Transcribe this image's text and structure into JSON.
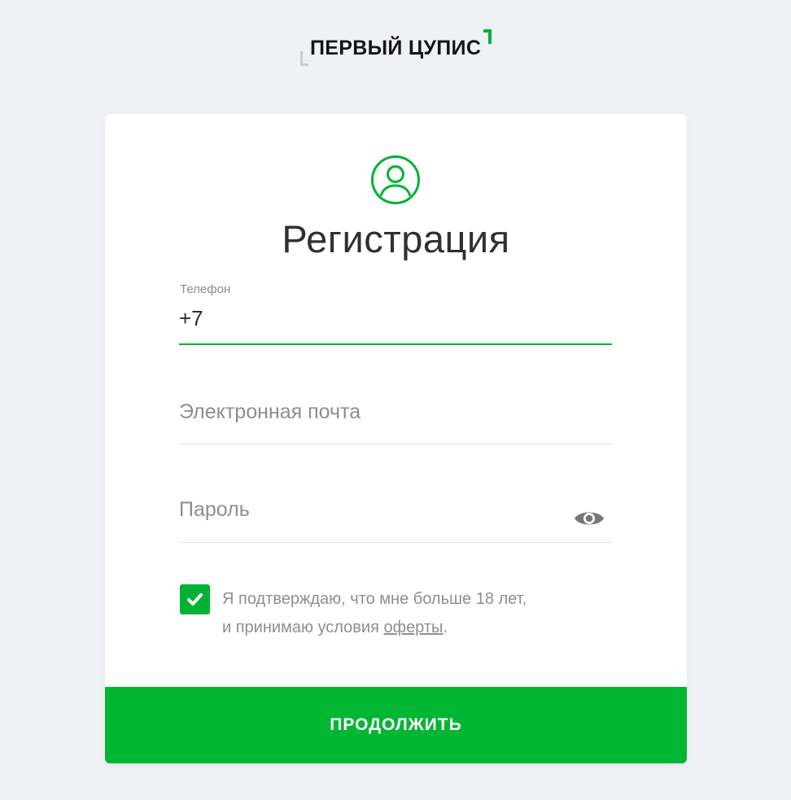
{
  "logo": {
    "text": "ПЕРВЫЙ ЦУПИС"
  },
  "form": {
    "title": "Регистрация",
    "phone": {
      "label": "Телефон",
      "value": "+7"
    },
    "email": {
      "placeholder": "Электронная почта"
    },
    "password": {
      "placeholder": "Пароль"
    },
    "consent": {
      "checked": true,
      "line1": "Я подтверждаю, что мне больше 18 лет,",
      "line2_prefix": "и принимаю условия ",
      "link": "оферты",
      "line2_suffix": "."
    },
    "submit_label": "ПРОДОЛЖИТЬ"
  },
  "colors": {
    "accent": "#00b233",
    "background": "#eff1f5",
    "card": "#ffffff"
  }
}
